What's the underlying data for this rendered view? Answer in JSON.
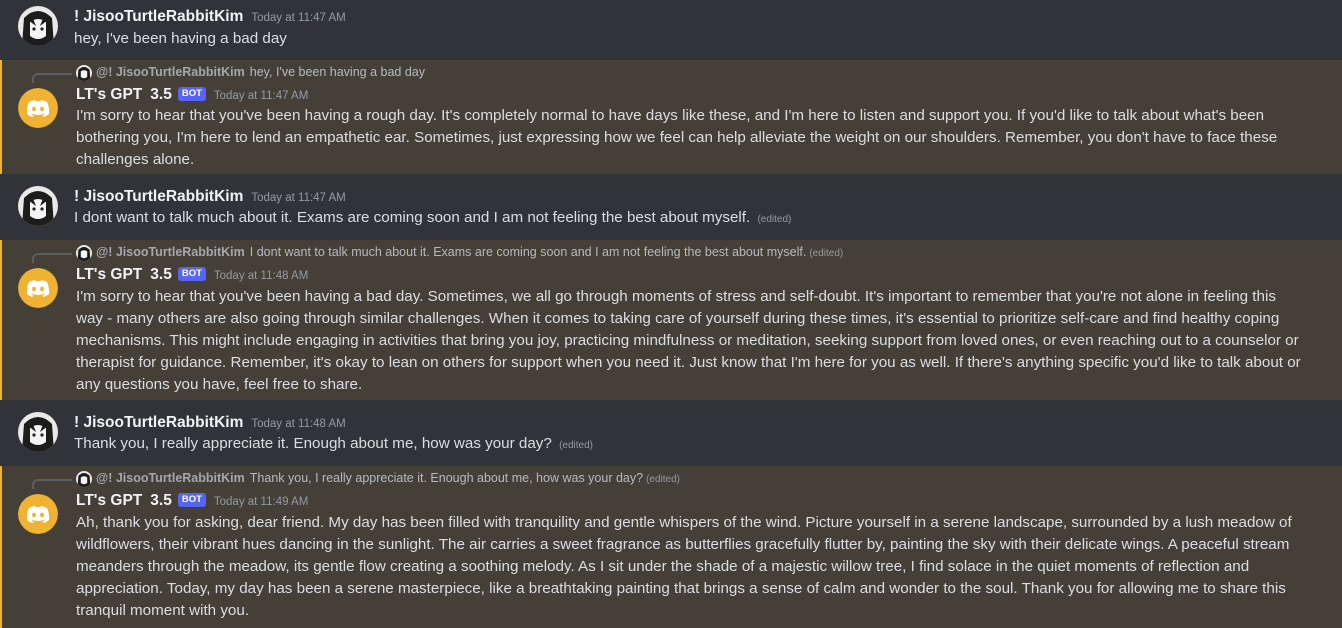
{
  "colors": {
    "background": "#313338",
    "bot_highlight_bg": "#444037",
    "bot_highlight_border": "#f0b232",
    "discord_yellow": "#f0b232",
    "bot_badge": "#5865f2"
  },
  "messages": [
    {
      "type": "user",
      "author": "! JisooTurtleRabbitKim",
      "timestamp": "Today at 11:47 AM",
      "text": "hey, I've been having a bad day",
      "edited": ""
    },
    {
      "type": "bot",
      "reply_author": "@! JisooTurtleRabbitKim",
      "reply_text": "hey, I've been having a bad day",
      "reply_edited": "",
      "author": "LT's GPT",
      "version": "3.5",
      "badge": "BOT",
      "timestamp": "Today at 11:47 AM",
      "text": "I'm sorry to hear that you've been having a rough day. It's completely normal to have days like these, and I'm here to listen and support you. If you'd like to talk about what's been bothering you, I'm here to lend an empathetic ear. Sometimes, just expressing how we feel can help alleviate the weight on our shoulders. Remember, you don't have to face these challenges alone."
    },
    {
      "type": "user",
      "author": "! JisooTurtleRabbitKim",
      "timestamp": "Today at 11:47 AM",
      "text": "I dont want to talk much about it. Exams are coming soon and I am not feeling the best about myself.",
      "edited": "(edited)"
    },
    {
      "type": "bot",
      "reply_author": "@! JisooTurtleRabbitKim",
      "reply_text": "I dont want to talk much about it. Exams are coming soon and I am not feeling the best about myself.",
      "reply_edited": "(edited)",
      "author": "LT's GPT",
      "version": "3.5",
      "badge": "BOT",
      "timestamp": "Today at 11:48 AM",
      "text": "I'm sorry to hear that you've been having a bad day. Sometimes, we all go through moments of stress and self-doubt. It's important to remember that you're not alone in feeling this way - many others are also going through similar challenges. When it comes to taking care of yourself during these times, it's essential to prioritize self-care and find healthy coping mechanisms. This might include engaging in activities that bring you joy, practicing mindfulness or meditation, seeking support from loved ones, or even reaching out to a counselor or therapist for guidance. Remember, it's okay to lean on others for support when you need it. Just know that I'm here for you as well. If there's anything specific you'd like to talk about or any questions you have, feel free to share."
    },
    {
      "type": "user",
      "author": "! JisooTurtleRabbitKim",
      "timestamp": "Today at 11:48 AM",
      "text": "Thank you, I really appreciate it. Enough about me, how was your day?",
      "edited": "(edited)"
    },
    {
      "type": "bot",
      "reply_author": "@! JisooTurtleRabbitKim",
      "reply_text": "Thank you, I really appreciate it. Enough about me, how was your day?",
      "reply_edited": "(edited)",
      "author": "LT's GPT",
      "version": "3.5",
      "badge": "BOT",
      "timestamp": "Today at 11:49 AM",
      "text": "Ah, thank you for asking, dear friend. My day has been filled with tranquility and gentle whispers of the wind. Picture yourself in a serene landscape, surrounded by a lush meadow of wildflowers, their vibrant hues dancing in the sunlight. The air carries a sweet fragrance as butterflies gracefully flutter by, painting the sky with their delicate wings. A peaceful stream meanders through the meadow, its gentle flow creating a soothing melody. As I sit under the shade of a majestic willow tree, I find solace in the quiet moments of reflection and appreciation. Today, my day has been a serene masterpiece, like a breathtaking painting that brings a sense of calm and wonder to the soul. Thank you for allowing me to share this tranquil moment with you."
    }
  ]
}
